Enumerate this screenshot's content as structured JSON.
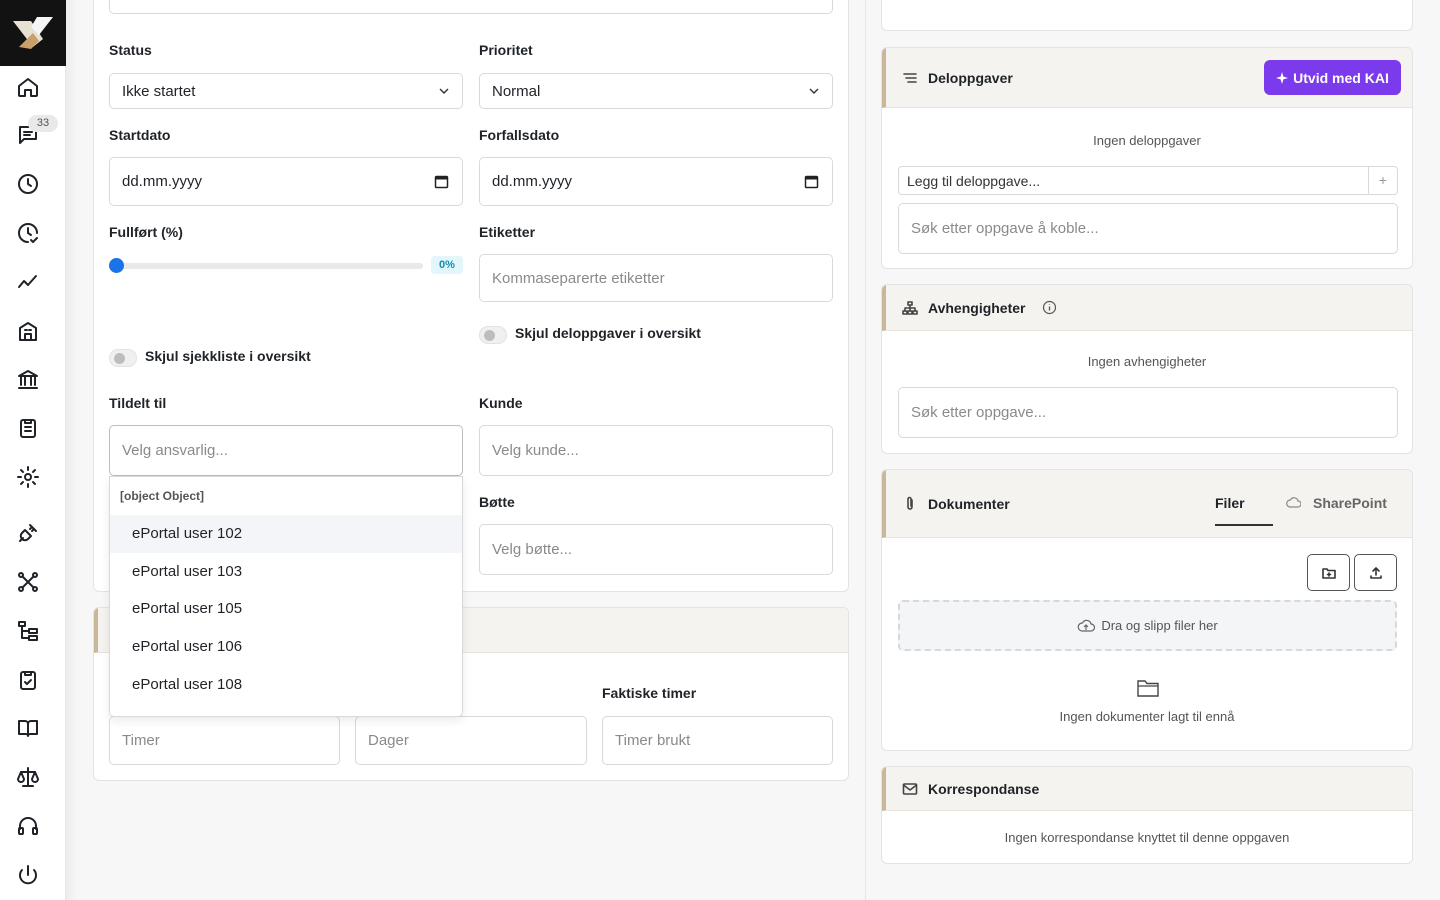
{
  "sidebar": {
    "badge_count": "33",
    "icons": [
      "home-icon",
      "chat-icon",
      "clock-icon",
      "clock-check-icon",
      "trend-icon",
      "building-icon",
      "bank-icon",
      "clipboard-list-icon",
      "settings-gear-icon",
      "plug-icon",
      "network-icon",
      "tree-icon",
      "clipboard-check-icon",
      "book-icon",
      "scales-icon",
      "headset-icon",
      "power-icon"
    ]
  },
  "form": {
    "status": {
      "label": "Status",
      "value": "Ikke startet"
    },
    "priority": {
      "label": "Prioritet",
      "value": "Normal"
    },
    "start_date": {
      "label": "Startdato",
      "value": "dd.mm.yyyy"
    },
    "due_date": {
      "label": "Forfallsdato",
      "value": "dd.mm.yyyy"
    },
    "completed": {
      "label": "Fullført (%)",
      "value": 0,
      "display": "0%"
    },
    "tags": {
      "label": "Etiketter",
      "placeholder": "Kommaseparerte etiketter"
    },
    "hide_subtasks": {
      "label": "Skjul deloppgaver i oversikt",
      "on": false
    },
    "hide_checklist": {
      "label": "Skjul sjekkliste i oversikt",
      "on": false
    },
    "assigned": {
      "label": "Tildelt til",
      "placeholder": "Velg ansvarlig..."
    },
    "customer": {
      "label": "Kunde",
      "placeholder": "Velg kunde..."
    },
    "bucket": {
      "label": "Bøtte",
      "placeholder": "Velg bøtte..."
    }
  },
  "dropdown": {
    "group": "[object Object]",
    "items": [
      "ePortal user 102",
      "ePortal user 103",
      "ePortal user 105",
      "ePortal user 106",
      "ePortal user 108"
    ]
  },
  "time": {
    "actual_label": "Faktiske timer",
    "hours_placeholder": "Timer",
    "days_placeholder": "Dager",
    "used_placeholder": "Timer brukt"
  },
  "subtasks": {
    "title": "Deloppgaver",
    "kai_button": "Utvid med KAI",
    "empty": "Ingen deloppgaver",
    "add_placeholder": "Legg til deloppgave...",
    "search_placeholder": "Søk etter oppgave å koble..."
  },
  "dependencies": {
    "title": "Avhengigheter",
    "empty": "Ingen avhengigheter",
    "search_placeholder": "Søk etter oppgave..."
  },
  "documents": {
    "title": "Dokumenter",
    "tab_files": "Filer",
    "tab_sharepoint": "SharePoint",
    "drop_text": "Dra og slipp filer her",
    "empty": "Ingen dokumenter lagt til ennå"
  },
  "correspondence": {
    "title": "Korrespondanse",
    "empty": "Ingen korrespondanse knyttet til denne oppgaven"
  },
  "colors": {
    "accent": "#7c3aed",
    "slider": "#1a73e8",
    "section_border": "#c9b79a"
  }
}
